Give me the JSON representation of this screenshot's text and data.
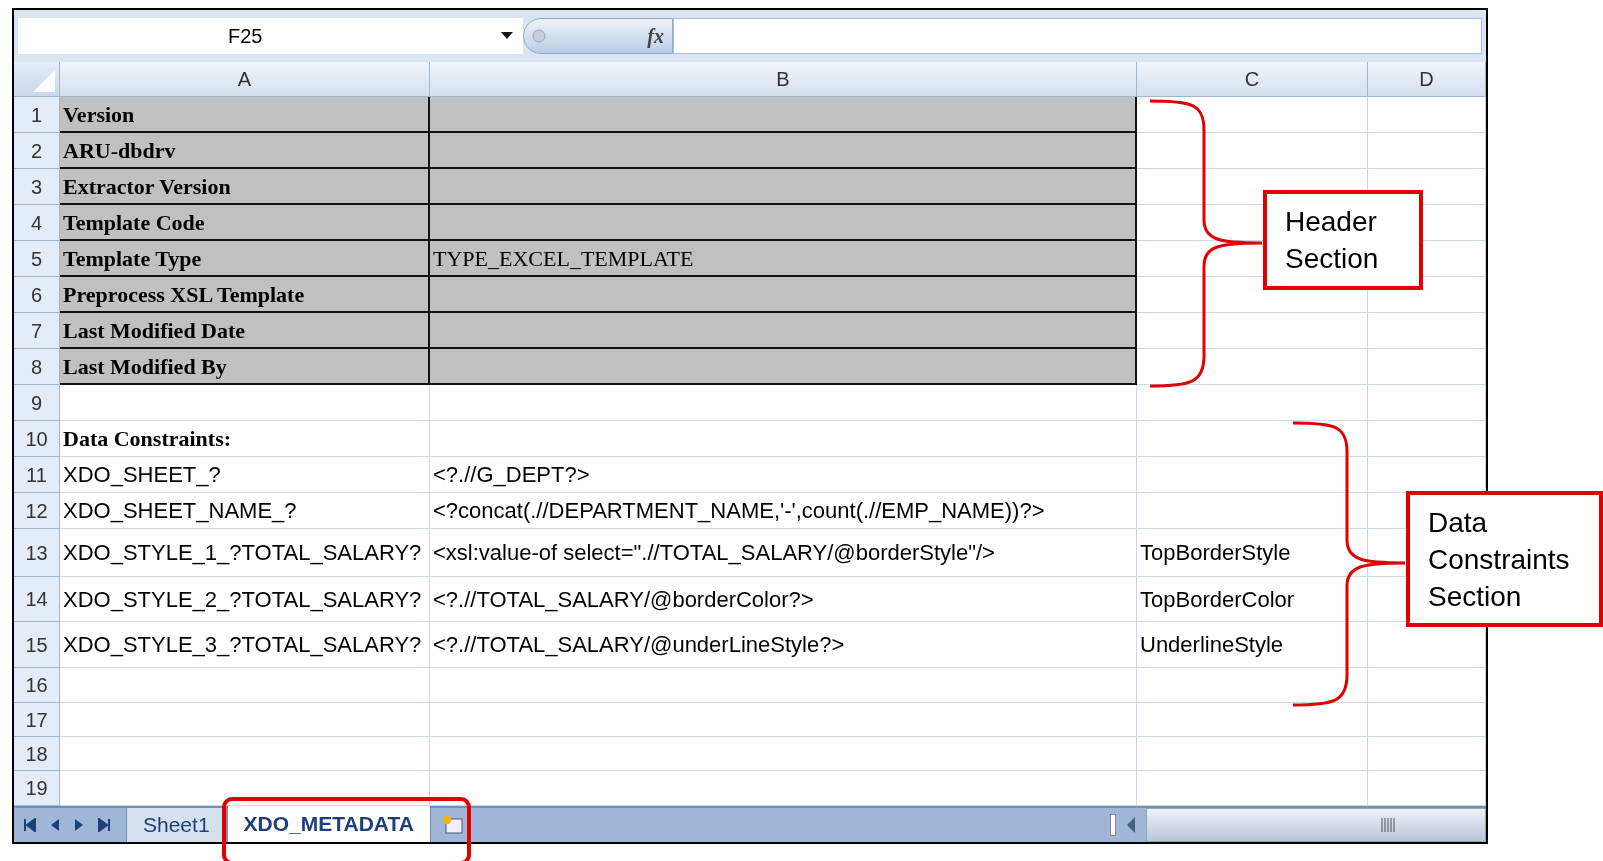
{
  "name_box": "F25",
  "formula_bar": {
    "function_label": "fx"
  },
  "columns": [
    "A",
    "B",
    "C",
    "D"
  ],
  "rows": [
    {
      "number": "1",
      "kind": "header-field",
      "cells": {
        "a": "Version"
      }
    },
    {
      "number": "2",
      "kind": "header-field",
      "cells": {
        "a": "ARU-dbdrv"
      }
    },
    {
      "number": "3",
      "kind": "header-field",
      "cells": {
        "a": "Extractor Version"
      }
    },
    {
      "number": "4",
      "kind": "header-field",
      "cells": {
        "a": "Template Code"
      }
    },
    {
      "number": "5",
      "kind": "header-field",
      "cells": {
        "a": "Template Type",
        "b": "TYPE_EXCEL_TEMPLATE"
      }
    },
    {
      "number": "6",
      "kind": "header-field",
      "cells": {
        "a": "Preprocess XSL Template"
      }
    },
    {
      "number": "7",
      "kind": "header-field",
      "cells": {
        "a": "Last Modified Date"
      }
    },
    {
      "number": "8",
      "kind": "header-field",
      "cells": {
        "a": "Last Modified By"
      }
    },
    {
      "number": "9",
      "kind": "data",
      "cells": {}
    },
    {
      "number": "10",
      "kind": "section-title",
      "cells": {
        "a": "Data Constraints:"
      }
    },
    {
      "number": "11",
      "kind": "data",
      "cells": {
        "a": "XDO_SHEET_?",
        "b": "<?.//G_DEPT?>"
      }
    },
    {
      "number": "12",
      "kind": "data",
      "cells": {
        "a": "XDO_SHEET_NAME_?",
        "b": "<?concat(.//DEPARTMENT_NAME,'-',count(.//EMP_NAME))?>"
      }
    },
    {
      "number": "13",
      "kind": "data",
      "cells": {
        "a": "XDO_STYLE_1_?TOTAL_SALARY?",
        "b": "<xsl:value-of select=\".//TOTAL_SALARY/@borderStyle\"/>",
        "c": "TopBorderStyle"
      }
    },
    {
      "number": "14",
      "kind": "data",
      "cells": {
        "a": "XDO_STYLE_2_?TOTAL_SALARY?",
        "b": "<?.//TOTAL_SALARY/@borderColor?>",
        "c": "TopBorderColor"
      }
    },
    {
      "number": "15",
      "kind": "data",
      "cells": {
        "a": "XDO_STYLE_3_?TOTAL_SALARY?",
        "b": "<?.//TOTAL_SALARY/@underLineStyle?>",
        "c": "UnderlineStyle"
      }
    },
    {
      "number": "16",
      "kind": "data",
      "cells": {}
    },
    {
      "number": "17",
      "kind": "data",
      "cells": {}
    },
    {
      "number": "18",
      "kind": "data",
      "cells": {}
    },
    {
      "number": "19",
      "kind": "data",
      "cells": {}
    }
  ],
  "sheet_tabs": [
    {
      "label": "Sheet1",
      "selected": false
    },
    {
      "label": "XDO_METADATA",
      "selected": true
    }
  ],
  "annotations": [
    {
      "text": "Header\nSection"
    },
    {
      "text": "Data\nConstraints\nSection"
    }
  ]
}
